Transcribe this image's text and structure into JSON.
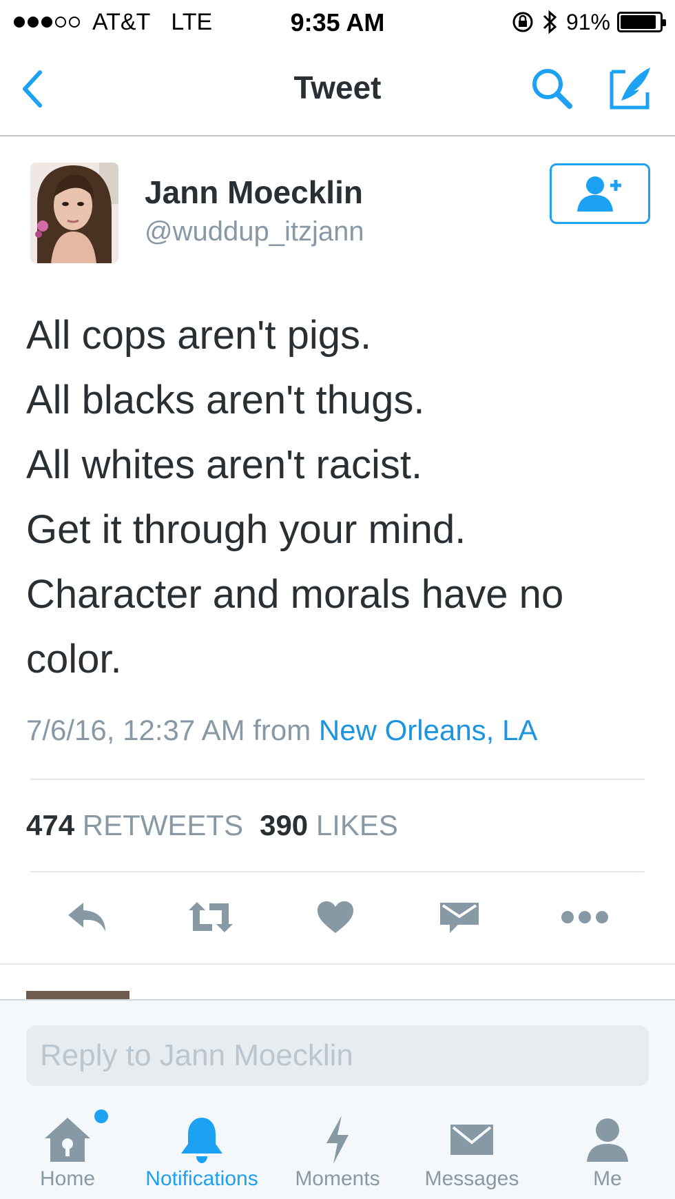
{
  "status_bar": {
    "carrier": "AT&T",
    "network": "LTE",
    "time": "9:35 AM",
    "battery": "91%",
    "battery_level": 0.91,
    "signal_bars_filled": 3,
    "signal_bars_total": 5
  },
  "nav": {
    "title": "Tweet",
    "back_icon": "chevron-left-icon",
    "search_icon": "search-icon",
    "compose_icon": "compose-icon"
  },
  "tweet": {
    "author_name": "Jann Moecklin",
    "author_handle": "@wuddup_itzjann",
    "text_lines": [
      "All cops aren't pigs.",
      "All blacks aren't thugs.",
      "All whites aren't racist.",
      "Get it through your mind.",
      "Character and morals have no",
      "color."
    ],
    "timestamp": "7/6/16, 12:37 AM",
    "from_label": "from",
    "location": "New Orleans, LA",
    "retweets_count": "474",
    "retweets_label": "RETWEETS",
    "likes_count": "390",
    "likes_label": "LIKES"
  },
  "actions": [
    {
      "icon": "reply-icon"
    },
    {
      "icon": "retweet-icon"
    },
    {
      "icon": "heart-icon"
    },
    {
      "icon": "direct-message-icon"
    },
    {
      "icon": "more-icon"
    }
  ],
  "reply": {
    "placeholder": "Reply to Jann Moecklin"
  },
  "tabs": [
    {
      "label": "Home",
      "icon": "home-icon",
      "active": false
    },
    {
      "label": "Notifications",
      "icon": "bell-icon",
      "active": true
    },
    {
      "label": "Moments",
      "icon": "lightning-icon",
      "active": false
    },
    {
      "label": "Messages",
      "icon": "envelope-icon",
      "active": false
    },
    {
      "label": "Me",
      "icon": "person-icon",
      "active": false
    }
  ],
  "colors": {
    "accent": "#1da1f2",
    "link": "#1b95e0",
    "muted": "#8899a6",
    "text": "#292f33",
    "icon_gray": "#8899a6"
  }
}
